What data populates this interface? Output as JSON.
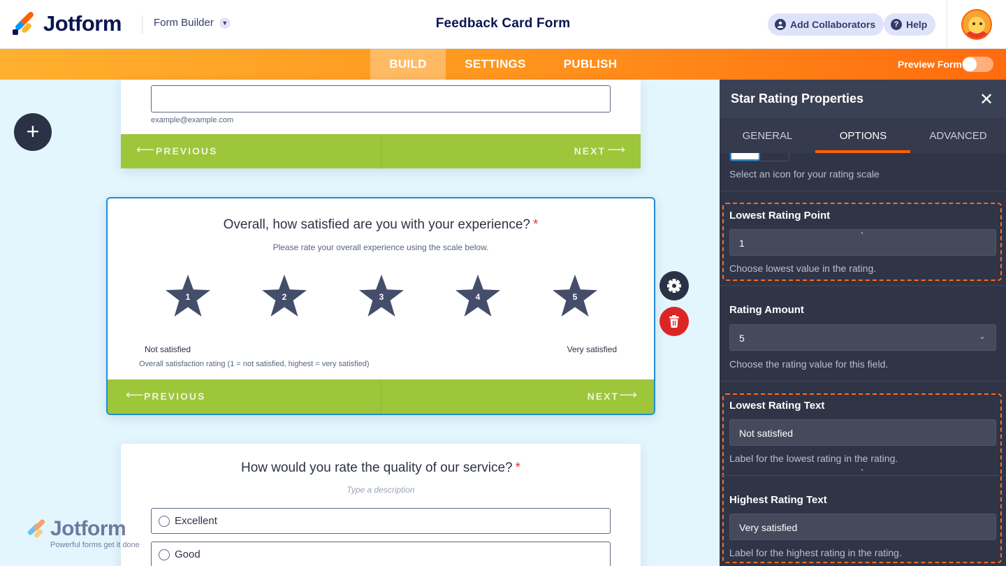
{
  "app": {
    "logo_text": "Jotform",
    "builder_switch_label": "Form Builder",
    "form_title": "Feedback Card Form",
    "add_collaborators_label": "Add Collaborators",
    "help_label": "Help"
  },
  "nav": {
    "tabs": [
      {
        "label": "BUILD",
        "active": true
      },
      {
        "label": "SETTINGS",
        "active": false
      },
      {
        "label": "PUBLISH",
        "active": false
      }
    ],
    "preview_label": "Preview Form",
    "preview_on": false
  },
  "canvas": {
    "card1": {
      "email_sublabel": "example@example.com",
      "prev_label": "PREVIOUS",
      "next_label": "NEXT"
    },
    "card2": {
      "question": "Overall, how satisfied are you with your experience?",
      "required_mark": "*",
      "description": "Please rate your overall experience using the scale below.",
      "stars": [
        "1",
        "2",
        "3",
        "4",
        "5"
      ],
      "lowest_label": "Not satisfied",
      "highest_label": "Very satisfied",
      "sublabel": "Overall satisfaction rating (1 = not satisfied, highest = very satisfied)",
      "prev_label": "PREVIOUS",
      "next_label": "NEXT"
    },
    "card3": {
      "question": "How would you rate the quality of our service?",
      "required_mark": "*",
      "description_placeholder": "Type a description",
      "options": [
        "Excellent",
        "Good"
      ]
    },
    "watermark": {
      "logo_text": "Jotform",
      "tagline": "Powerful forms get it done"
    }
  },
  "panel": {
    "title": "Star Rating Properties",
    "tabs": [
      {
        "label": "GENERAL",
        "active": false
      },
      {
        "label": "OPTIONS",
        "active": true
      },
      {
        "label": "ADVANCED",
        "active": false
      }
    ],
    "icon_help": "Select an icon for your rating scale",
    "lowest_point": {
      "label": "Lowest Rating Point",
      "value": "1",
      "help": "Choose lowest value in the rating."
    },
    "rating_amount": {
      "label": "Rating Amount",
      "value": "5",
      "help": "Choose the rating value for this field."
    },
    "lowest_text": {
      "label": "Lowest Rating Text",
      "value": "Not satisfied",
      "help": "Label for the lowest rating in the rating."
    },
    "highest_text": {
      "label": "Highest Rating Text",
      "value": "Very satisfied",
      "help": "Label for the highest rating in the rating."
    }
  },
  "colors": {
    "brand_orange": "#ff6100",
    "canvas_bg": "#e3f6fd",
    "nav_green": "#9dc63b",
    "panel_bg": "#2f3446",
    "star": "#444e6b",
    "selected_border": "#1f8dd6",
    "required": "#e23b3b"
  }
}
